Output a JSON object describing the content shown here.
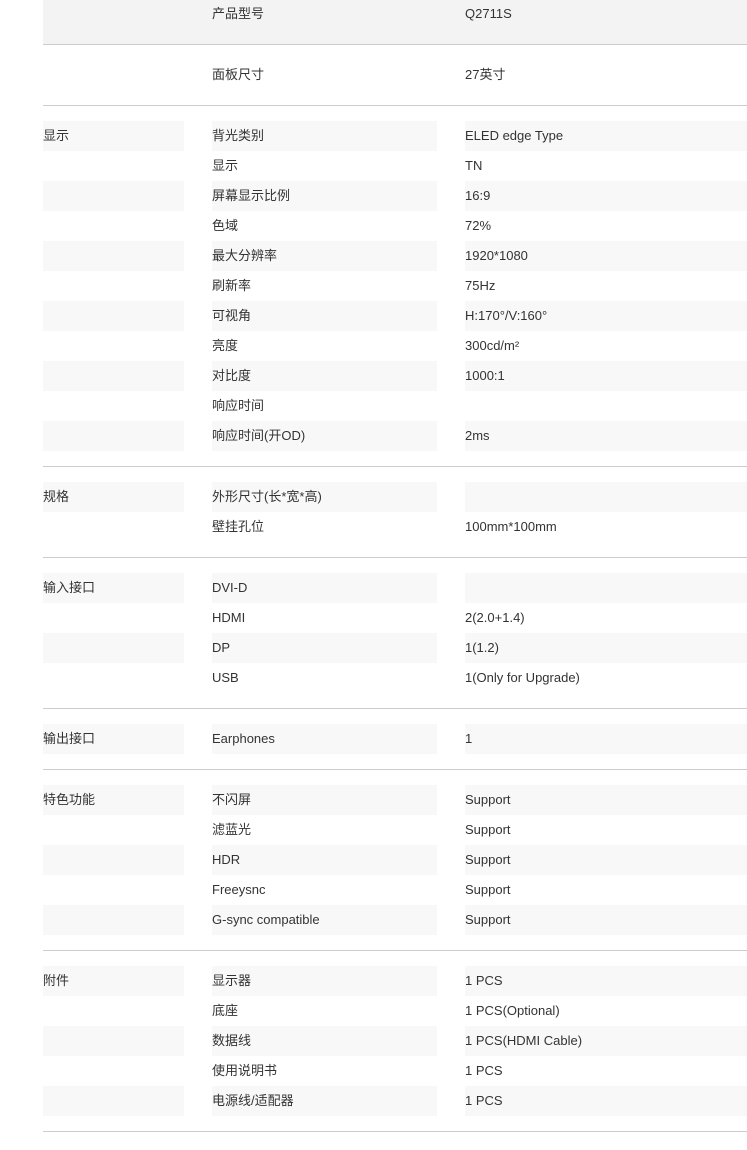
{
  "header": {
    "model": {
      "label": "产品型号",
      "value": "Q2711S"
    },
    "panel_size": {
      "label": "面板尺寸",
      "value": "27英寸"
    }
  },
  "sections": [
    {
      "title": "显示",
      "rows": [
        {
          "label": "背光类别",
          "value": "ELED edge Type"
        },
        {
          "label": "显示",
          "value": "TN"
        },
        {
          "label": "屏幕显示比例",
          "value": "16:9"
        },
        {
          "label": "色域",
          "value": "72%"
        },
        {
          "label": "最大分辨率",
          "value": "1920*1080"
        },
        {
          "label": "刷新率",
          "value": "75Hz"
        },
        {
          "label": "可视角",
          "value": "H:170°/V:160°"
        },
        {
          "label": "亮度",
          "value": "300cd/m²"
        },
        {
          "label": "对比度",
          "value": "1000:1"
        },
        {
          "label": "响应时间",
          "value": ""
        },
        {
          "label": "响应时间(开OD)",
          "value": "2ms"
        }
      ]
    },
    {
      "title": "规格",
      "rows": [
        {
          "label": "外形尺寸(长*宽*高)",
          "value": ""
        },
        {
          "label": "壁挂孔位",
          "value": "100mm*100mm"
        }
      ]
    },
    {
      "title": "输入接口",
      "rows": [
        {
          "label": "DVI-D",
          "value": ""
        },
        {
          "label": "HDMI",
          "value": "2(2.0+1.4)"
        },
        {
          "label": "DP",
          "value": "1(1.2)"
        },
        {
          "label": "USB",
          "value": "1(Only for Upgrade)"
        }
      ]
    },
    {
      "title": "输出接口",
      "rows": [
        {
          "label": "Earphones",
          "value": "1"
        }
      ]
    },
    {
      "title": "特色功能",
      "rows": [
        {
          "label": "不闪屏",
          "value": "Support"
        },
        {
          "label": "滤蓝光",
          "value": "Support"
        },
        {
          "label": "HDR",
          "value": "Support"
        },
        {
          "label": "Freeysnc",
          "value": "Support"
        },
        {
          "label": "G-sync compatible",
          "value": "Support"
        }
      ]
    },
    {
      "title": "附件",
      "rows": [
        {
          "label": "显示器",
          "value": "1 PCS"
        },
        {
          "label": "底座",
          "value": "1 PCS(Optional)"
        },
        {
          "label": "数据线",
          "value": "1 PCS(HDMI Cable)"
        },
        {
          "label": "使用说明书",
          "value": "1 PCS"
        },
        {
          "label": "电源线/适配器",
          "value": "1 PCS"
        }
      ]
    }
  ]
}
